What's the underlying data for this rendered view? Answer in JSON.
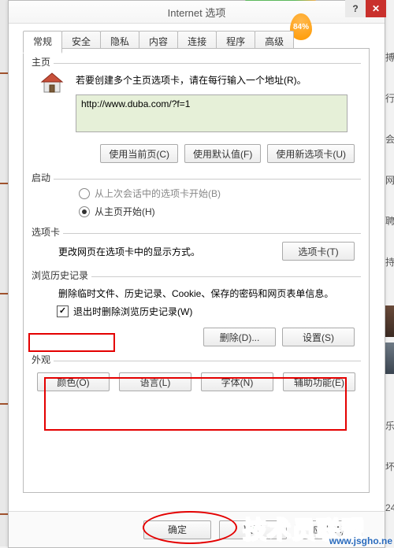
{
  "window": {
    "title": "Internet 选项",
    "help": "?",
    "close": "✕"
  },
  "badge": "84%",
  "tabs": [
    "常规",
    "安全",
    "隐私",
    "内容",
    "连接",
    "程序",
    "高级"
  ],
  "home": {
    "label": "主页",
    "intro": "若要创建多个主页选项卡，请在每行输入一个地址(R)。",
    "url": "http://www.duba.com/?f=1",
    "btn_current": "使用当前页(C)",
    "btn_default": "使用默认值(F)",
    "btn_newtab": "使用新选项卡(U)"
  },
  "startup": {
    "label": "启动",
    "opt_last": "从上次会话中的选项卡开始(B)",
    "opt_home": "从主页开始(H)"
  },
  "tabs_section": {
    "label": "选项卡",
    "desc": "更改网页在选项卡中的显示方式。",
    "btn": "选项卡(T)"
  },
  "history": {
    "label": "浏览历史记录",
    "desc": "删除临时文件、历史记录、Cookie、保存的密码和网页表单信息。",
    "cb": "退出时删除浏览历史记录(W)",
    "btn_delete": "删除(D)...",
    "btn_settings": "设置(S)"
  },
  "appearance": {
    "label": "外观",
    "btn_colors": "颜色(O)",
    "btn_lang": "语言(L)",
    "btn_font": "字体(N)",
    "btn_access": "辅助功能(E)"
  },
  "footer": {
    "ok": "确定",
    "cancel": "取消",
    "apply": "应用(A)"
  },
  "side": "搏\n\n行\n\n会\n\n网\n\n聘\n\n持\n\n\n\n\n\n\n\n乐\n\n坏\n\n24",
  "watermark": "技术员联盟",
  "watermark_sub": "www.jsgho.ne"
}
